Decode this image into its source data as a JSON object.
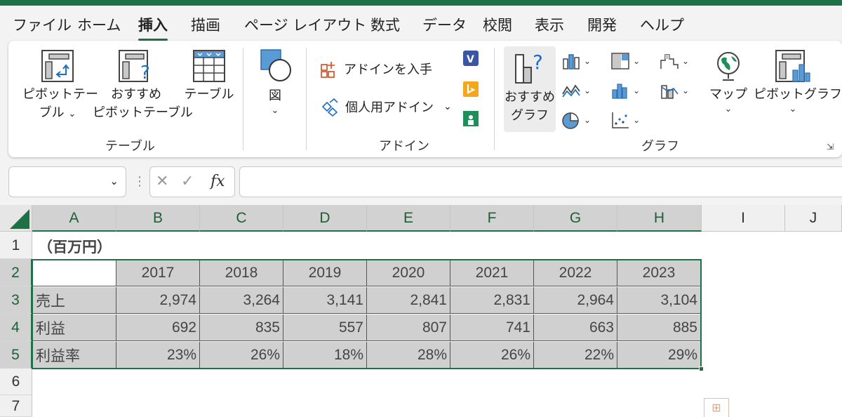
{
  "tabs": [
    "ファイル",
    "ホーム",
    "挿入",
    "描画",
    "ページ レイアウト",
    "数式",
    "データ",
    "校閲",
    "表示",
    "開発",
    "ヘルプ"
  ],
  "active_tab": "挿入",
  "ribbon": {
    "pivot_table": [
      "ピボットテー",
      "ブル"
    ],
    "recommended_pivot": [
      "おすすめ",
      "ピボットテーブル"
    ],
    "table": "テーブル",
    "group_table": "テーブル",
    "illustrations": "図",
    "get_addins": "アドインを入手",
    "my_addins": "個人用アドイン",
    "group_addins": "アドイン",
    "recommended_charts": [
      "おすすめ",
      "グラフ"
    ],
    "maps": "マップ",
    "pivot_chart": "ピボットグラフ",
    "group_charts": "グラフ"
  },
  "formula_bar": {
    "name_box": "",
    "cancel_symbol": "✕",
    "enter_symbol": "✓",
    "fx_label": "fx",
    "formula": ""
  },
  "columns": [
    "A",
    "B",
    "C",
    "D",
    "E",
    "F",
    "G",
    "H",
    "I",
    "J"
  ],
  "rows": [
    "1",
    "2",
    "3",
    "4",
    "5",
    "6",
    "7"
  ],
  "sheet": {
    "unit_label": "（百万円）",
    "years": [
      "2017",
      "2018",
      "2019",
      "2020",
      "2021",
      "2022",
      "2023"
    ],
    "data_rows": [
      {
        "label": "売上",
        "values": [
          "2,974",
          "3,264",
          "3,141",
          "2,841",
          "2,831",
          "2,964",
          "3,104"
        ]
      },
      {
        "label": "利益",
        "values": [
          "692",
          "835",
          "557",
          "807",
          "741",
          "663",
          "885"
        ]
      },
      {
        "label": "利益率",
        "values": [
          "23%",
          "26%",
          "18%",
          "28%",
          "26%",
          "22%",
          "29%"
        ]
      }
    ]
  },
  "colors": {
    "accent": "#1e7145",
    "selection_fill": "#d0d0d0"
  }
}
